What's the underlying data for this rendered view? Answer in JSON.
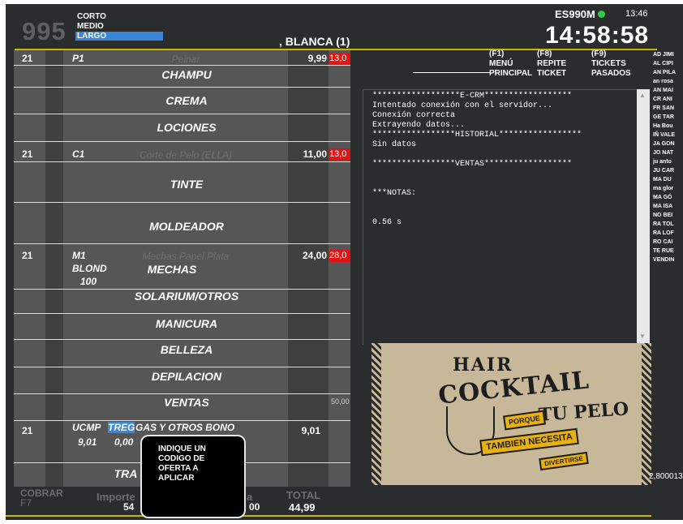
{
  "header": {
    "code": "995",
    "lengths": [
      "CORTO",
      "MEDIO",
      "LARGO"
    ],
    "selected_length": "LARGO",
    "client_name": ", BLANCA (1)",
    "terminal": "ES990M",
    "status_color": "#2ecc40",
    "small_time": "13:46",
    "clock": "14:58:58"
  },
  "ticket": {
    "categories": [
      "CHAMPU",
      "CREMA",
      "LOCIONES",
      "TINTE",
      "MOLDEADOR",
      "MECHAS",
      "SOLARIUM/OTROS",
      "MANICURA",
      "BELLEZA",
      "DEPILACION",
      "VENTAS",
      "TRA"
    ],
    "category_suffix": "GAS Y OTROS BONO",
    "lines": [
      {
        "qty": "21",
        "code": "P1",
        "service": "Peinar",
        "price": "9,99",
        "red": "13,0"
      },
      {
        "qty": "21",
        "code": "C1",
        "service": "Corte de Pelo (ELLA)",
        "price": "11,00",
        "red": "13,0"
      },
      {
        "qty": "21",
        "code": "M1",
        "code2": "BLOND",
        "code3": "100",
        "service": "Mechas Papel Plata",
        "price": "24,00",
        "red": "28,0"
      },
      {
        "qty": "21",
        "code": "UCMP",
        "highlight": "TREG",
        "sub1": "9,01",
        "sub2": "0,00",
        "price": "9,01"
      }
    ],
    "ventas_value": "50,00"
  },
  "footer": {
    "cobrar": "COBRAR",
    "f7": "F7",
    "importe_label": "Importe",
    "importe_value": "54",
    "partial_label": "a",
    "partial_value": "00",
    "total_label": "TOTAL",
    "total_value": "44,99"
  },
  "popup": {
    "text": "INDIQUE UN\nCODIGO DE\nOFERTA A\nAPLICAR"
  },
  "function_keys": [
    {
      "key": "(F1)",
      "line1": "MENÚ",
      "line2": "PRINCIPAL"
    },
    {
      "key": "(F8)",
      "line1": "REPITE",
      "line2": "TICKET"
    },
    {
      "key": "(F9)",
      "line1": "TICKETS",
      "line2": "PASADOS"
    }
  ],
  "console": {
    "text": "******************E-CRM******************\nIntentado conexión con el servidor...\nConexión correcta\nExtrayendo datos...\n*****************HISTORIAL*****************\nSin datos\n\n*****************VENTAS******************\n\n\n***NOTAS:\n\n\n0.56 s"
  },
  "banner": {
    "hair": "HAIR",
    "cocktail": "COCKTAIL",
    "tu_pelo": "TU PELO",
    "porque": "PORQUE",
    "tambien": "TAMBIEN NECESITA",
    "divertirse": "DIVERTIRSE"
  },
  "side_value": "2,800013",
  "name_list": [
    "AD JIMI",
    "AL CIPI",
    "AN PILA",
    "an rosa",
    "AN MAI",
    "CR ANI",
    "FR SAN",
    "GE TAR",
    "Ha Bou",
    "IÑ VALE",
    "JA GON",
    "JO NAT",
    "ju anto",
    "JU CAR",
    "MA DU",
    "ma glor",
    "MA GÓ",
    "MA ISA",
    "NO BEI",
    "RA TOL",
    "RA LOF",
    "RO CAI",
    "TE RUE",
    "VENDIN"
  ]
}
